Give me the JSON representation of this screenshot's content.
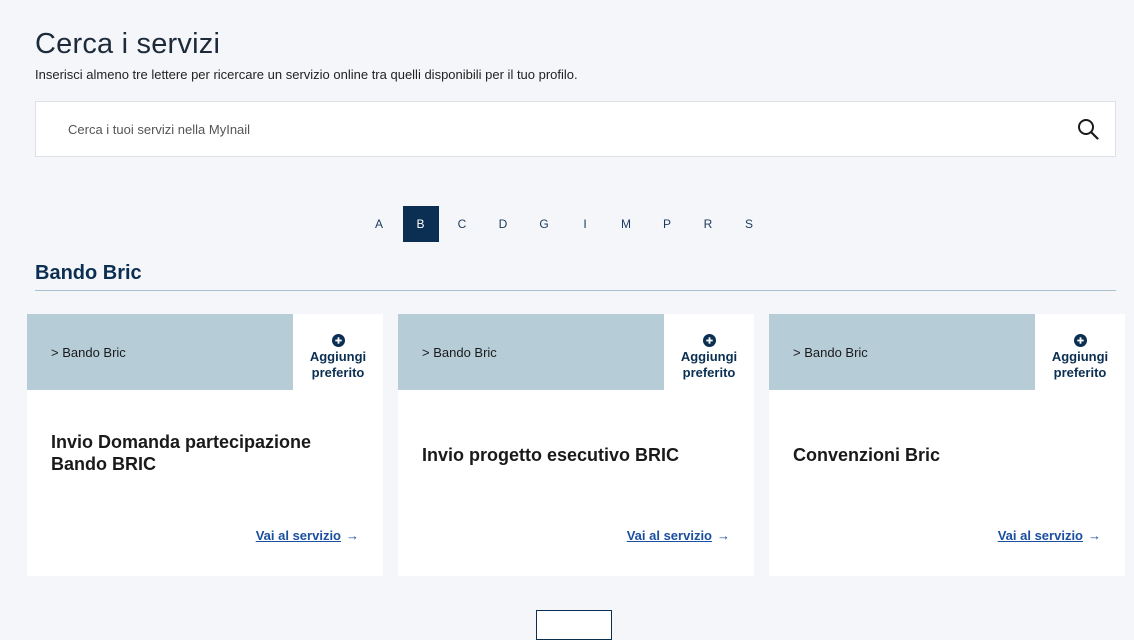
{
  "header": {
    "title": "Cerca i servizi",
    "subtitle": "Inserisci almeno tre lettere per ricercare un servizio online tra quelli disponibili per il tuo profilo."
  },
  "search": {
    "placeholder": "Cerca i tuoi servizi nella MyInail",
    "value": "",
    "icon": "search-icon"
  },
  "alphabet": {
    "letters": [
      "A",
      "B",
      "C",
      "D",
      "G",
      "I",
      "M",
      "P",
      "R",
      "S"
    ],
    "active": "B"
  },
  "section": {
    "title": "Bando Bric"
  },
  "cards": [
    {
      "breadcrumb": "> Bando Bric",
      "fav_line1": "Aggiungi",
      "fav_line2": "preferito",
      "title": "Invio Domanda partecipazione Bando BRIC",
      "link": "Vai al servizio",
      "arrow": "→"
    },
    {
      "breadcrumb": "> Bando Bric",
      "fav_line1": "Aggiungi",
      "fav_line2": "preferito",
      "title": "Invio progetto esecutivo BRIC",
      "link": "Vai al servizio",
      "arrow": "→"
    },
    {
      "breadcrumb": "> Bando Bric",
      "fav_line1": "Aggiungi",
      "fav_line2": "preferito",
      "title": "Convenzioni Bric",
      "link": "Vai al servizio",
      "arrow": "→"
    }
  ],
  "colors": {
    "background": "#f5f6fa",
    "primary": "#0b2f52",
    "card_header": "#b6cdd8",
    "link": "#1b4fa0"
  }
}
